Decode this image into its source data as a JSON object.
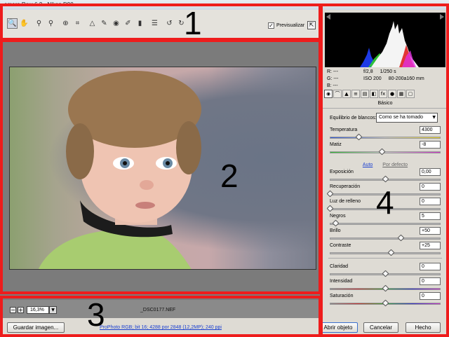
{
  "window": {
    "title": "amera Raw 6.2 -  Nikon D90"
  },
  "toolbar": {
    "tools": [
      {
        "name": "zoom-tool",
        "icon": "magnifier-icon",
        "glyph": "🔍",
        "active": true
      },
      {
        "name": "hand-tool",
        "icon": "hand-icon",
        "glyph": "✋"
      },
      {
        "name": "white-balance-tool",
        "icon": "eyedropper-icon",
        "glyph": "⚲"
      },
      {
        "name": "color-sampler-tool",
        "icon": "eyedropper-plus-icon",
        "glyph": "⚲"
      },
      {
        "name": "targeted-adjust-tool",
        "icon": "target-icon",
        "glyph": "⊕"
      },
      {
        "name": "crop-tool",
        "icon": "crop-icon",
        "glyph": "⌗"
      },
      {
        "name": "straighten-tool",
        "icon": "straighten-icon",
        "glyph": "△"
      },
      {
        "name": "spot-removal-tool",
        "icon": "spot-icon",
        "glyph": "✎"
      },
      {
        "name": "red-eye-tool",
        "icon": "red-eye-icon",
        "glyph": "◉"
      },
      {
        "name": "adjustment-brush-tool",
        "icon": "brush-icon",
        "glyph": "✐"
      },
      {
        "name": "graduated-filter-tool",
        "icon": "gradient-icon",
        "glyph": "▮"
      },
      {
        "name": "preferences-tool",
        "icon": "list-icon",
        "glyph": "☰"
      },
      {
        "name": "rotate-left-tool",
        "icon": "rotate-left-icon",
        "glyph": "↺"
      },
      {
        "name": "rotate-right-tool",
        "icon": "rotate-right-icon",
        "glyph": "↻"
      }
    ],
    "preview_label": "Previsualizar",
    "preview_checked": "✓"
  },
  "zoom": {
    "value": "16,3%",
    "minus": "−",
    "plus": "+"
  },
  "file": {
    "name": "_DSC0177.NEF"
  },
  "workflow": {
    "text": "ProPhoto RGB; bit 16; 4288 por 2848 (12,2MP); 240 ppi"
  },
  "buttons": {
    "save": "Guardar imagen...",
    "open": "Abrir objeto",
    "cancel": "Cancelar",
    "done": "Hecho"
  },
  "info": {
    "r": "R:  ---",
    "g": "G:  ---",
    "b": "B:  ---",
    "aperture": "f/2,8",
    "shutter": "1/250 s",
    "iso": "ISO 200",
    "lens": "80-200a160 mm"
  },
  "panel": {
    "tabs": [
      "basic-icon",
      "tone-curve-icon",
      "detail-icon",
      "hsl-icon",
      "split-toning-icon",
      "lens-icon",
      "fx-icon",
      "camera-calibration-icon",
      "presets-icon",
      "snapshots-icon"
    ],
    "tab_glyphs": [
      "◉",
      "⌒",
      "▲",
      "≡",
      "▤",
      "◧",
      "fx",
      "●",
      "▦",
      "▢"
    ],
    "section_title": "Básico",
    "white_balance_label": "Equilibrio de blancos:",
    "white_balance_value": "Como se ha tomado",
    "temperature": {
      "label": "Temperatura",
      "value": "4300",
      "pos": 0.26
    },
    "tint": {
      "label": "Matiz",
      "value": "-8",
      "pos": 0.47
    },
    "auto_link": "Auto",
    "default_link": "Por defecto",
    "sliders": [
      {
        "name": "exposure",
        "label": "Exposición",
        "value": "0,00",
        "pos": 0.5,
        "kind": ""
      },
      {
        "name": "recovery",
        "label": "Recuperación",
        "value": "0",
        "pos": 0.0,
        "kind": ""
      },
      {
        "name": "fill-light",
        "label": "Luz de relleno",
        "value": "0",
        "pos": 0.0,
        "kind": ""
      },
      {
        "name": "blacks",
        "label": "Negros",
        "value": "5",
        "pos": 0.05,
        "kind": ""
      },
      {
        "name": "brightness",
        "label": "Brillo",
        "value": "+50",
        "pos": 0.64,
        "kind": ""
      },
      {
        "name": "contrast",
        "label": "Contraste",
        "value": "+25",
        "pos": 0.55,
        "kind": ""
      },
      {
        "name": "clarity",
        "label": "Claridad",
        "value": "0",
        "pos": 0.5,
        "kind": ""
      },
      {
        "name": "vibrance",
        "label": "Intensidad",
        "value": "0",
        "pos": 0.5,
        "kind": "sat"
      },
      {
        "name": "saturation",
        "label": "Saturación",
        "value": "0",
        "pos": 0.5,
        "kind": "sat"
      }
    ]
  },
  "annotations": [
    "1",
    "2",
    "3",
    "4"
  ],
  "colors": {
    "highlight": "#ee1c1c",
    "link": "#1a3fd0"
  }
}
